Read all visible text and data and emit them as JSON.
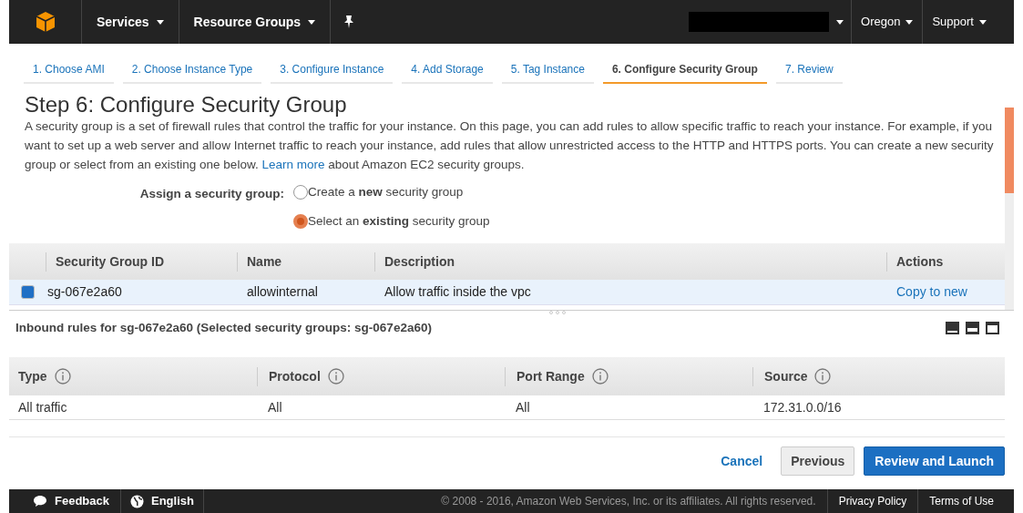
{
  "top_nav": {
    "menus": [
      {
        "label": "Services"
      },
      {
        "label": "Resource Groups"
      }
    ],
    "right_menus": [
      {
        "label": "Oregon"
      },
      {
        "label": "Support"
      }
    ]
  },
  "wizard_steps": [
    {
      "label": "1. Choose AMI",
      "selected": false
    },
    {
      "label": "2. Choose Instance Type",
      "selected": false
    },
    {
      "label": "3. Configure Instance",
      "selected": false
    },
    {
      "label": "4. Add Storage",
      "selected": false
    },
    {
      "label": "5. Tag Instance",
      "selected": false
    },
    {
      "label": "6. Configure Security Group",
      "selected": true
    },
    {
      "label": "7. Review",
      "selected": false
    }
  ],
  "title": "Step 6: Configure Security Group",
  "intro": {
    "before": "A security group is a set of firewall rules that control the traffic for your instance. On this page, you can add rules to allow specific traffic to reach your instance. For example, if you want to set up a web server and allow Internet traffic to reach your instance, add rules that allow unrestricted access to the HTTP and HTTPS ports. You can create a new security group or select from an existing one below.",
    "link": "Learn more",
    "after": "about Amazon EC2 security groups."
  },
  "assign": {
    "label": "Assign a security group:",
    "options": [
      {
        "label": "Create a **new** security group",
        "selected": false
      },
      {
        "label": "Select an **existing** security group",
        "selected": true
      }
    ]
  },
  "groups_table": {
    "columns": [
      "Security Group ID",
      "Name",
      "Description",
      "Actions"
    ],
    "rows": [
      {
        "id": "sg-067e2a60",
        "name": "allowinternal",
        "description": "Allow traffic inside the vpc",
        "action": "Copy to new",
        "checked": true,
        "selected": true
      }
    ]
  },
  "inbound": {
    "heading": "Inbound rules for sg-067e2a60 (Selected security groups: sg-067e2a60)",
    "columns": [
      "Type",
      "Protocol",
      "Port Range",
      "Source"
    ],
    "rows": [
      [
        "All traffic",
        "All",
        "All",
        "172.31.0.0/16"
      ]
    ]
  },
  "buttons": {
    "cancel": "Cancel",
    "previous": "Previous",
    "primary": "Review and Launch"
  },
  "footer": {
    "feedback": "Feedback",
    "language": "English",
    "copyright": "© 2008 - 2016, Amazon Web Services, Inc. or its affiliates. All rights reserved.",
    "links": [
      "Privacy Policy",
      "Terms of Use"
    ]
  }
}
